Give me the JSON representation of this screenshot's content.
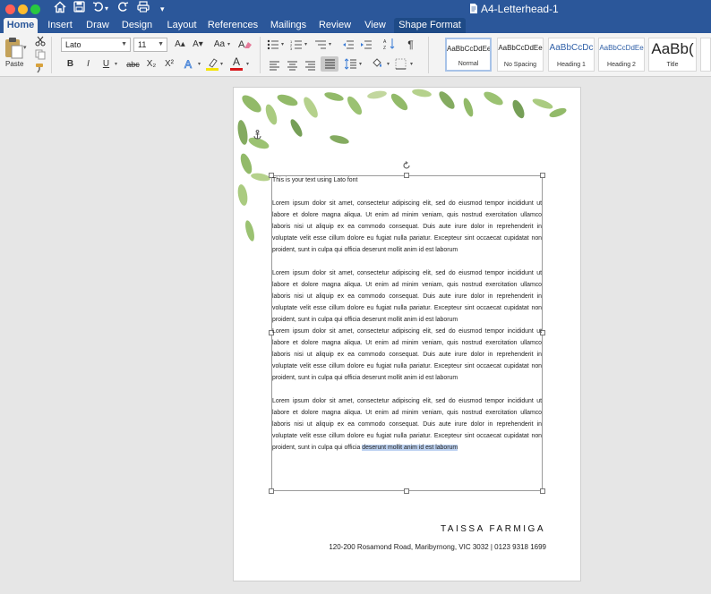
{
  "window": {
    "title": "A4-Letterhead-1"
  },
  "colors": {
    "accent": "#2b579a",
    "highlight": "#bed3f2",
    "leaf_green": "#7fae4f"
  },
  "quick_access": {
    "icons": [
      "home-icon",
      "save-icon",
      "undo-icon",
      "redo-icon",
      "print-icon",
      "customize-icon"
    ]
  },
  "tabs": [
    "Home",
    "Insert",
    "Draw",
    "Design",
    "Layout",
    "References",
    "Mailings",
    "Review",
    "View",
    "Shape Format"
  ],
  "ribbon": {
    "paste_label": "Paste",
    "font_name": "Lato",
    "font_size": "11",
    "grow_label": "A▴",
    "shrink_label": "A▾",
    "case_label": "Aa",
    "bold": "B",
    "italic": "I",
    "underline": "U",
    "strike": "abc",
    "subscript": "X₂",
    "superscript": "X²",
    "font_color_letter": "A",
    "highlight_color": "#f5e400",
    "font_color": "#d8171b",
    "styles": [
      {
        "sample": "AaBbCcDdEe",
        "name": "Normal",
        "selected": true
      },
      {
        "sample": "AaBbCcDdEe",
        "name": "No Spacing",
        "selected": false
      },
      {
        "sample": "AaBbCcDc",
        "name": "Heading 1",
        "selected": false
      },
      {
        "sample": "AaBbCcDdEe",
        "name": "Heading 2",
        "selected": false
      },
      {
        "sample": "AaBb(",
        "name": "Title",
        "selected": false
      }
    ]
  },
  "document": {
    "heading_line": "This is your text using Lato font",
    "paragraphs": [
      [
        "Lorem ipsum dolor sit amet, consectetur adipiscing elit, sed do eiusmod tempor incididunt ut",
        "labore et dolore magna aliqua. Ut enim ad minim veniam, quis nostrud exercitation ullamco",
        "laboris nisi ut aliquip ex ea commodo consequat. Duis aute irure dolor in reprehenderit in",
        "voluptate velit esse cillum dolore eu fugiat nulla pariatur. Excepteur sint occaecat cupidatat non",
        "proident, sunt in culpa qui officia deserunt mollit anim id est laborum"
      ],
      [
        "Lorem ipsum dolor sit amet, consectetur adipiscing elit, sed do eiusmod tempor incididunt ut",
        "labore et dolore magna aliqua. Ut enim ad minim veniam, quis nostrud exercitation ullamco",
        "laboris nisi ut aliquip ex ea commodo consequat. Duis aute irure dolor in reprehenderit in",
        "voluptate velit esse cillum dolore eu fugiat nulla pariatur. Excepteur sint occaecat cupidatat non",
        "proident, sunt in culpa qui officia deserunt mollit anim id est laborum"
      ],
      [
        "Lorem ipsum dolor sit amet, consectetur adipiscing elit, sed do eiusmod tempor incididunt ut",
        "labore et dolore magna aliqua. Ut enim ad minim veniam, quis nostrud exercitation ullamco",
        "laboris nisi ut aliquip ex ea commodo consequat. Duis aute irure dolor in reprehenderit in",
        "voluptate velit esse cillum dolore eu fugiat nulla pariatur. Excepteur sint occaecat cupidatat non",
        "proident, sunt in culpa qui officia deserunt mollit anim id est laborum"
      ],
      [
        "Lorem ipsum dolor sit amet, consectetur adipiscing elit, sed do eiusmod tempor incididunt ut",
        "labore et dolore magna aliqua. Ut enim ad minim veniam, quis nostrud exercitation ullamco",
        "laboris nisi ut aliquip ex ea commodo consequat. Duis aute irure dolor in reprehenderit in",
        "voluptate velit esse cillum dolore eu fugiat nulla pariatur. Excepteur sint occaecat cupidatat non"
      ]
    ],
    "last_line_plain": "proident, sunt in culpa qui officia ",
    "last_line_selected": "deserunt mollit anim id est laborum",
    "signature_name": "TAISSA FARMIGA",
    "signature_address": "120-200 Rosamond Road, Maribyrnong, VIC 3032  | 0123 9318 1699"
  }
}
